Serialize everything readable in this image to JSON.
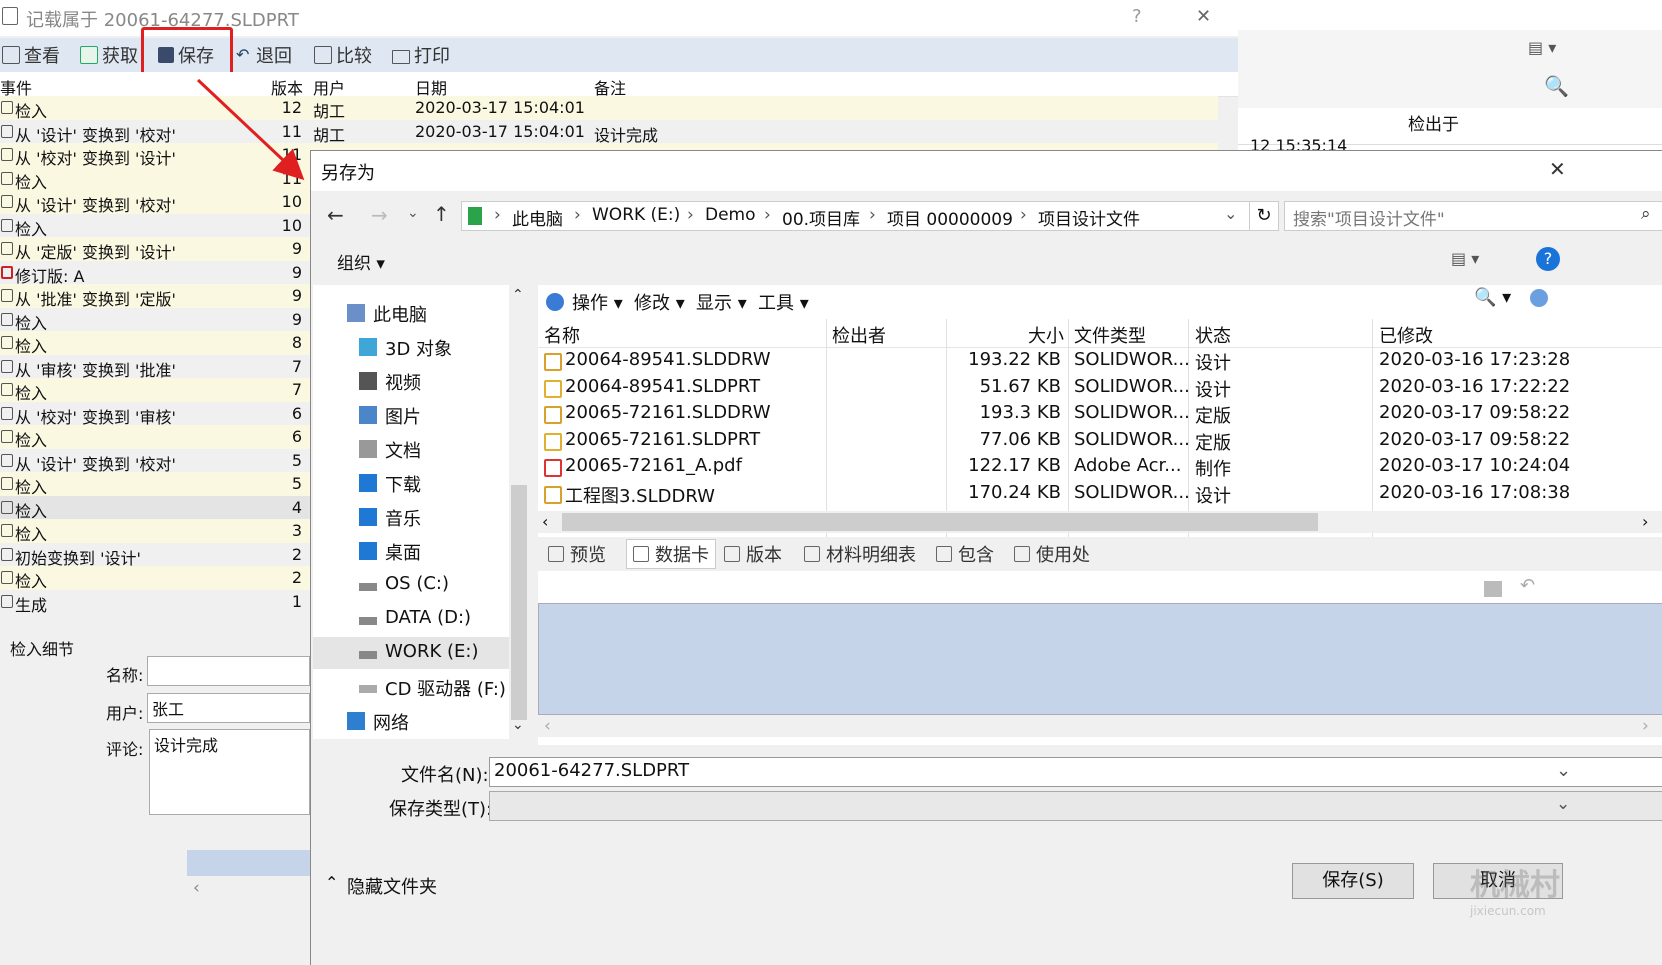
{
  "history_window": {
    "title": "记载属于 20061-64277.SLDPRT",
    "help": "?",
    "close": "✕",
    "toolbar": [
      {
        "label": "查看",
        "icon": "view-icon"
      },
      {
        "label": "获取",
        "icon": "get-icon"
      },
      {
        "label": "保存",
        "icon": "save-icon"
      },
      {
        "label": "退回",
        "icon": "undo-icon"
      },
      {
        "label": "比较",
        "icon": "compare-icon"
      },
      {
        "label": "打印",
        "icon": "print-icon"
      }
    ],
    "columns": {
      "event": "事件",
      "version": "版本",
      "user": "用户",
      "date": "日期",
      "note": "备注"
    },
    "rows": [
      {
        "event": "检入",
        "version": "12",
        "user": "胡工",
        "date": "2020-03-17 15:04:01",
        "note": "",
        "style": "yel"
      },
      {
        "event": "从 '设计' 变换到 '校对'",
        "version": "11",
        "user": "胡工",
        "date": "2020-03-17 15:04:01",
        "note": "设计完成",
        "style": ""
      },
      {
        "event": "从 '校对' 变换到 '设计'",
        "version": "11",
        "user": "",
        "date": "",
        "note": "",
        "style": "yel"
      },
      {
        "event": "检入",
        "version": "11",
        "user": "",
        "date": "",
        "note": "",
        "style": "yel"
      },
      {
        "event": "从 '设计' 变换到 '校对'",
        "version": "10",
        "user": "",
        "date": "",
        "note": "",
        "style": "yel"
      },
      {
        "event": "检入",
        "version": "10",
        "user": "",
        "date": "",
        "note": "",
        "style": ""
      },
      {
        "event": "从 '定版' 变换到 '设计'",
        "version": "9",
        "user": "",
        "date": "",
        "note": "",
        "style": "yel"
      },
      {
        "event": "修订版: A",
        "version": "9",
        "user": "",
        "date": "",
        "note": "",
        "style": ""
      },
      {
        "event": "从 '批准' 变换到 '定版'",
        "version": "9",
        "user": "",
        "date": "",
        "note": "",
        "style": "yel"
      },
      {
        "event": "检入",
        "version": "9",
        "user": "",
        "date": "",
        "note": "",
        "style": ""
      },
      {
        "event": "检入",
        "version": "8",
        "user": "",
        "date": "",
        "note": "",
        "style": "yel"
      },
      {
        "event": "从 '审核' 变换到 '批准'",
        "version": "7",
        "user": "",
        "date": "",
        "note": "",
        "style": ""
      },
      {
        "event": "检入",
        "version": "7",
        "user": "",
        "date": "",
        "note": "",
        "style": "yel"
      },
      {
        "event": "从 '校对' 变换到 '审核'",
        "version": "6",
        "user": "",
        "date": "",
        "note": "",
        "style": ""
      },
      {
        "event": "检入",
        "version": "6",
        "user": "",
        "date": "",
        "note": "",
        "style": "yel"
      },
      {
        "event": "从 '设计' 变换到 '校对'",
        "version": "5",
        "user": "",
        "date": "",
        "note": "",
        "style": ""
      },
      {
        "event": "检入",
        "version": "5",
        "user": "",
        "date": "",
        "note": "",
        "style": "yel"
      },
      {
        "event": "检入",
        "version": "4",
        "user": "",
        "date": "",
        "note": "",
        "style": "sel"
      },
      {
        "event": "检入",
        "version": "3",
        "user": "",
        "date": "",
        "note": "",
        "style": "yel"
      },
      {
        "event": "初始变换到 '设计'",
        "version": "2",
        "user": "",
        "date": "",
        "note": "",
        "style": ""
      },
      {
        "event": "检入",
        "version": "2",
        "user": "",
        "date": "",
        "note": "",
        "style": "yel"
      },
      {
        "event": "生成",
        "version": "1",
        "user": "",
        "date": "",
        "note": "",
        "style": ""
      }
    ],
    "detail": {
      "group": "检入细节",
      "name_label": "名称:",
      "name_value": "",
      "user_label": "用户:",
      "user_value": "张工",
      "comment_label": "评论:",
      "comment_value": "设计完成"
    }
  },
  "background_window": {
    "column": "检出于",
    "partial_date": "12 15:35:14"
  },
  "save_dialog": {
    "title": "另存为",
    "close": "✕",
    "breadcrumbs": [
      "此电脑",
      "WORK (E:)",
      "Demo",
      "00.项目库",
      "项目 00000009",
      "项目设计文件"
    ],
    "search_placeholder": "搜索\"项目设计文件\"",
    "organize": "组织 ▾",
    "help": "?",
    "nav_items": [
      {
        "label": "此电脑",
        "icon": "computer-icon",
        "indent": 0
      },
      {
        "label": "3D 对象",
        "icon": "3d-objects-icon",
        "indent": 1
      },
      {
        "label": "视频",
        "icon": "video-icon",
        "indent": 1
      },
      {
        "label": "图片",
        "icon": "pictures-icon",
        "indent": 1
      },
      {
        "label": "文档",
        "icon": "documents-icon",
        "indent": 1
      },
      {
        "label": "下载",
        "icon": "download-icon",
        "indent": 1
      },
      {
        "label": "音乐",
        "icon": "music-icon",
        "indent": 1
      },
      {
        "label": "桌面",
        "icon": "desktop-icon",
        "indent": 1
      },
      {
        "label": "OS (C:)",
        "icon": "drive-icon",
        "indent": 1
      },
      {
        "label": "DATA (D:)",
        "icon": "drive-icon",
        "indent": 1
      },
      {
        "label": "WORK (E:)",
        "icon": "drive-icon",
        "indent": 1
      },
      {
        "label": "CD 驱动器 (F:)",
        "icon": "cd-drive-icon",
        "indent": 1
      },
      {
        "label": "网络",
        "icon": "network-icon",
        "indent": 0
      }
    ],
    "pane_toolbar": [
      "操作",
      "修改",
      "显示",
      "工具"
    ],
    "file_columns": {
      "name": "名称",
      "checked_out_by": "检出者",
      "size": "大小",
      "type": "文件类型",
      "state": "状态",
      "modified": "已修改"
    },
    "files": [
      {
        "name": "20064-89541.SLDDRW",
        "checked_out_by": "",
        "size": "193.22 KB",
        "type": "SOLIDWOR...",
        "state": "设计",
        "modified": "2020-03-16 17:23:28",
        "icon": "drawing-file-icon"
      },
      {
        "name": "20064-89541.SLDPRT",
        "checked_out_by": "",
        "size": "51.67 KB",
        "type": "SOLIDWOR...",
        "state": "设计",
        "modified": "2020-03-16 17:22:22",
        "icon": "part-file-icon"
      },
      {
        "name": "20065-72161.SLDDRW",
        "checked_out_by": "",
        "size": "193.3 KB",
        "type": "SOLIDWOR...",
        "state": "定版",
        "modified": "2020-03-17 09:58:22",
        "icon": "drawing-file-icon"
      },
      {
        "name": "20065-72161.SLDPRT",
        "checked_out_by": "",
        "size": "77.06 KB",
        "type": "SOLIDWOR...",
        "state": "定版",
        "modified": "2020-03-17 09:58:22",
        "icon": "part-file-icon"
      },
      {
        "name": "20065-72161_A.pdf",
        "checked_out_by": "",
        "size": "122.17 KB",
        "type": "Adobe Acr...",
        "state": "制作",
        "modified": "2020-03-17 10:24:04",
        "icon": "pdf-file-icon"
      },
      {
        "name": "工程图3.SLDDRW",
        "checked_out_by": "",
        "size": "170.24 KB",
        "type": "SOLIDWOR...",
        "state": "设计",
        "modified": "2020-03-16 17:08:38",
        "icon": "drawing-file-icon"
      }
    ],
    "tabs": [
      {
        "label": "预览",
        "icon": "preview-icon"
      },
      {
        "label": "数据卡",
        "icon": "datacard-icon"
      },
      {
        "label": "版本",
        "icon": "version-icon"
      },
      {
        "label": "材料明细表",
        "icon": "bom-icon"
      },
      {
        "label": "包含",
        "icon": "contains-icon"
      },
      {
        "label": "使用处",
        "icon": "where-used-icon"
      }
    ],
    "filename_label": "文件名(N):",
    "filename_value": "20061-64277.SLDPRT",
    "filetype_label": "保存类型(T):",
    "filetype_value": "",
    "hide_folders": "隐藏文件夹",
    "save_button": "保存(S)",
    "cancel_button": "取消"
  },
  "watermark": {
    "text": "机械村",
    "sub": "jixiecun.com"
  }
}
